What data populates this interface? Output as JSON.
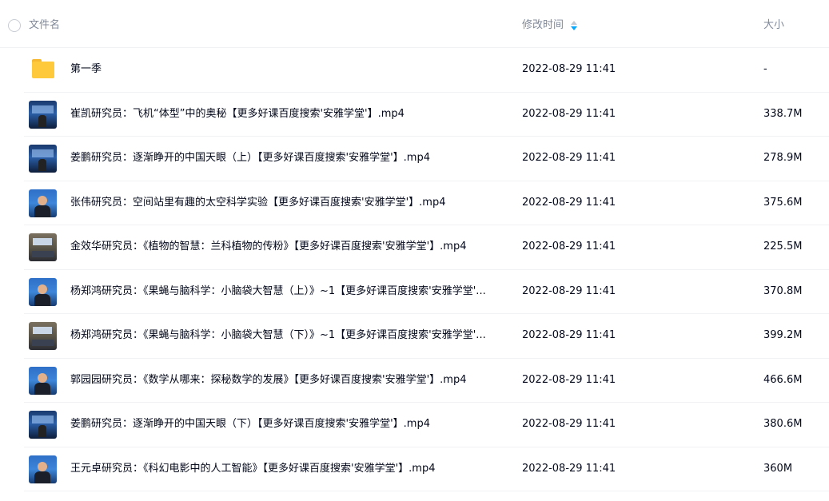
{
  "header": {
    "name_label": "文件名",
    "time_label": "修改时间",
    "size_label": "大小",
    "sort_icon": "sort-desc-icon",
    "accent_color": "#06a7ff"
  },
  "files": [
    {
      "type": "folder",
      "thumb": "folder-icon",
      "name": "第一季",
      "time": "2022-08-29 11:41",
      "size": "-"
    },
    {
      "type": "video",
      "thumb": "stage",
      "name": "崔凯研究员：飞机“体型”中的奥秘【更多好课百度搜索'安雅学堂'】.mp4",
      "time": "2022-08-29 11:41",
      "size": "338.7M"
    },
    {
      "type": "video",
      "thumb": "stage",
      "name": "姜鹏研究员：逐渐睁开的中国天眼（上）【更多好课百度搜索'安雅学堂'】.mp4",
      "time": "2022-08-29 11:41",
      "size": "278.9M"
    },
    {
      "type": "video",
      "thumb": "blue",
      "name": "张伟研究员：空间站里有趣的太空科学实验【更多好课百度搜索'安雅学堂'】.mp4",
      "time": "2022-08-29 11:41",
      "size": "375.6M"
    },
    {
      "type": "video",
      "thumb": "room",
      "name": "金效华研究员：《植物的智慧：兰科植物的传粉》【更多好课百度搜索'安雅学堂'】.mp4",
      "time": "2022-08-29 11:41",
      "size": "225.5M"
    },
    {
      "type": "video",
      "thumb": "blue",
      "name": "杨郑鸿研究员：《果蝇与脑科学：小脑袋大智慧（上）》~1【更多好课百度搜索'安雅学堂'...",
      "time": "2022-08-29 11:41",
      "size": "370.8M"
    },
    {
      "type": "video",
      "thumb": "room",
      "name": "杨郑鸿研究员：《果蝇与脑科学：小脑袋大智慧（下）》~1【更多好课百度搜索'安雅学堂'...",
      "time": "2022-08-29 11:41",
      "size": "399.2M"
    },
    {
      "type": "video",
      "thumb": "blue",
      "name": "郭园园研究员：《数学从哪来：探秘数学的发展》【更多好课百度搜索'安雅学堂'】.mp4",
      "time": "2022-08-29 11:41",
      "size": "466.6M"
    },
    {
      "type": "video",
      "thumb": "stage",
      "name": "姜鹏研究员：逐渐睁开的中国天眼（下）【更多好课百度搜索'安雅学堂'】.mp4",
      "time": "2022-08-29 11:41",
      "size": "380.6M"
    },
    {
      "type": "video",
      "thumb": "blue",
      "name": "王元卓研究员：《科幻电影中的人工智能》【更多好课百度搜索'安雅学堂'】.mp4",
      "time": "2022-08-29 11:41",
      "size": "360M"
    }
  ]
}
